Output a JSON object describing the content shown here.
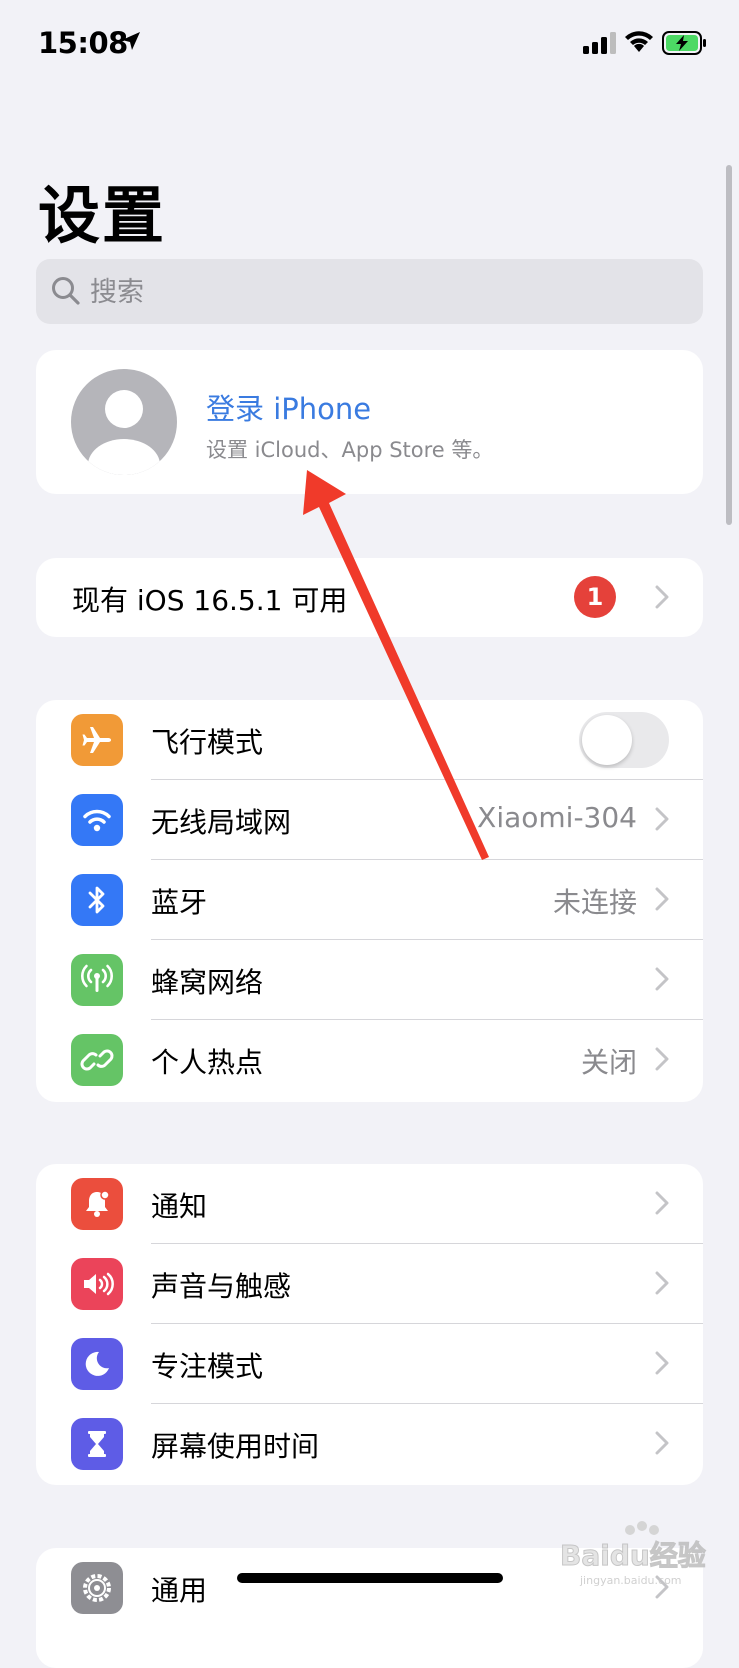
{
  "status_bar": {
    "time": "15:08",
    "battery_color": "#4cd964"
  },
  "page": {
    "title": "设置",
    "search_placeholder": "搜索"
  },
  "profile": {
    "title": "登录 iPhone",
    "subtitle": "设置 iCloud、App Store 等。"
  },
  "update": {
    "label": "现有 iOS 16.5.1 可用",
    "badge": "1"
  },
  "network_group": [
    {
      "label": "飞行模式",
      "icon": "airplane-icon",
      "color": "#f19a37",
      "toggle_on": false
    },
    {
      "label": "无线局域网",
      "icon": "wifi-icon",
      "color": "#3478f6",
      "value": "Xiaomi-304"
    },
    {
      "label": "蓝牙",
      "icon": "bluetooth-icon",
      "color": "#3478f6",
      "value": "未连接"
    },
    {
      "label": "蜂窝网络",
      "icon": "antenna-icon",
      "color": "#65c466",
      "value": ""
    },
    {
      "label": "个人热点",
      "icon": "hotspot-icon",
      "color": "#65c466",
      "value": "关闭"
    }
  ],
  "notification_group": [
    {
      "label": "通知",
      "icon": "bell-icon",
      "color": "#eb4e3d"
    },
    {
      "label": "声音与触感",
      "icon": "speaker-icon",
      "color": "#eb445a"
    },
    {
      "label": "专注模式",
      "icon": "moon-icon",
      "color": "#5e5ce6"
    },
    {
      "label": "屏幕使用时间",
      "icon": "hourglass-icon",
      "color": "#5e5ce6"
    }
  ],
  "general_group": [
    {
      "label": "通用",
      "icon": "gear-icon",
      "color": "#8e8e93"
    }
  ],
  "annotation": {
    "arrow_color": "#f03a2a"
  },
  "watermark": {
    "text": "Baidu经验",
    "url_text": "jingyan.baidu.com"
  }
}
